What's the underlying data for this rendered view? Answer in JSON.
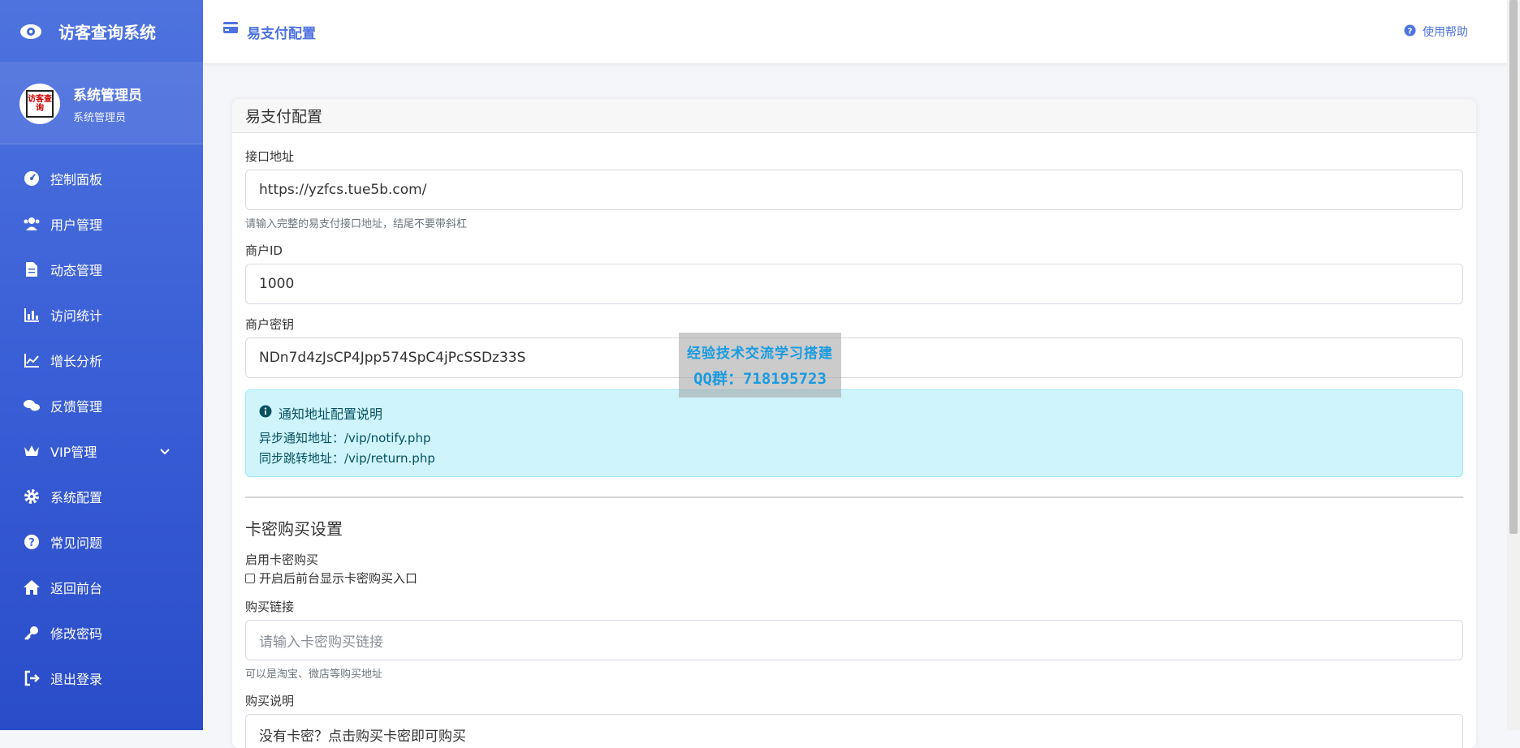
{
  "app": {
    "title": "访客查询系统"
  },
  "user": {
    "name": "系统管理员",
    "role": "系统管理员",
    "avatar_text": "访客查询"
  },
  "sidebar": {
    "items": [
      {
        "label": "控制面板",
        "icon": "dashboard-icon"
      },
      {
        "label": "用户管理",
        "icon": "users-icon"
      },
      {
        "label": "动态管理",
        "icon": "file-icon"
      },
      {
        "label": "访问统计",
        "icon": "bar-chart-icon"
      },
      {
        "label": "增长分析",
        "icon": "line-chart-icon"
      },
      {
        "label": "反馈管理",
        "icon": "comments-icon"
      },
      {
        "label": "VIP管理",
        "icon": "crown-icon"
      },
      {
        "label": "系统配置",
        "icon": "gear-icon"
      },
      {
        "label": "常见问题",
        "icon": "question-icon"
      },
      {
        "label": "返回前台",
        "icon": "home-icon"
      },
      {
        "label": "修改密码",
        "icon": "key-icon"
      },
      {
        "label": "退出登录",
        "icon": "logout-icon"
      }
    ]
  },
  "header": {
    "title": "易支付配置",
    "help": "使用帮助"
  },
  "card": {
    "title": "易支付配置",
    "api_url": {
      "label": "接口地址",
      "value": "https://yzfcs.tue5b.com/",
      "hint": "请输入完整的易支付接口地址，结尾不要带斜杠"
    },
    "merchant_id": {
      "label": "商户ID",
      "value": "1000"
    },
    "merchant_key": {
      "label": "商户密钥",
      "value": "NDn7d4zJsCP4Jpp574SpC4jPcSSDz33S"
    },
    "notice": {
      "title": "通知地址配置说明",
      "async": "异步通知地址：/vip/notify.php",
      "sync": "同步跳转地址：/vip/return.php"
    },
    "card_section": {
      "title": "卡密购买设置",
      "enable_label": "启用卡密购买",
      "enable_checkbox": "开启后前台显示卡密购买入口",
      "buy_link": {
        "label": "购买链接",
        "placeholder": "请输入卡密购买链接",
        "hint": "可以是淘宝、微店等购买地址"
      },
      "buy_desc": {
        "label": "购买说明",
        "value": "没有卡密？点击购买卡密即可购买"
      }
    }
  },
  "watermark": {
    "line1": "经验技术交流学习搭建",
    "line2": "QQ群：718195723"
  },
  "colors": {
    "primary": "#4e73df",
    "info_bg": "#cff4fc",
    "info_text": "#055160"
  }
}
